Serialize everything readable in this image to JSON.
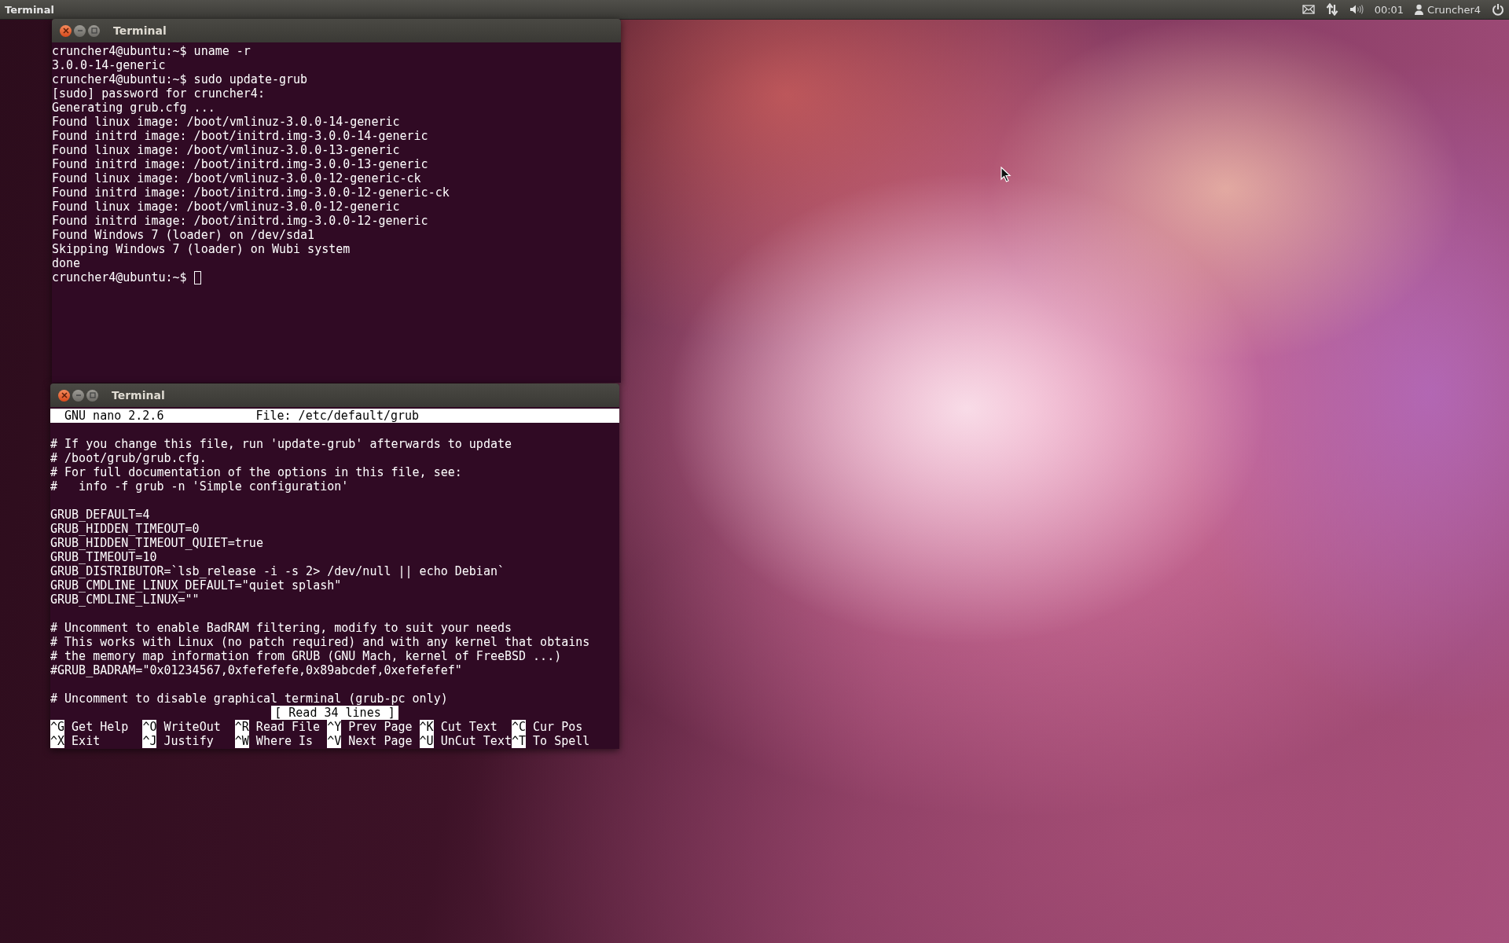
{
  "top_panel": {
    "app_title": "Terminal",
    "clock": "00:01",
    "user": "Cruncher4"
  },
  "windows": [
    {
      "kind": "shell",
      "title": "Terminal",
      "lines": [
        "cruncher4@ubuntu:~$ uname -r",
        "3.0.0-14-generic",
        "cruncher4@ubuntu:~$ sudo update-grub",
        "[sudo] password for cruncher4:",
        "Generating grub.cfg ...",
        "Found linux image: /boot/vmlinuz-3.0.0-14-generic",
        "Found initrd image: /boot/initrd.img-3.0.0-14-generic",
        "Found linux image: /boot/vmlinuz-3.0.0-13-generic",
        "Found initrd image: /boot/initrd.img-3.0.0-13-generic",
        "Found linux image: /boot/vmlinuz-3.0.0-12-generic-ck",
        "Found initrd image: /boot/initrd.img-3.0.0-12-generic-ck",
        "Found linux image: /boot/vmlinuz-3.0.0-12-generic",
        "Found initrd image: /boot/initrd.img-3.0.0-12-generic",
        "Found Windows 7 (loader) on /dev/sda1",
        "Skipping Windows 7 (loader) on Wubi system",
        "done"
      ],
      "prompt": "cruncher4@ubuntu:~$"
    },
    {
      "kind": "nano",
      "title": "Terminal",
      "version": "GNU nano 2.2.6",
      "file": "File: /etc/default/grub",
      "paragraphs": [
        [
          "# If you change this file, run 'update-grub' afterwards to update",
          "# /boot/grub/grub.cfg.",
          "# For full documentation of the options in this file, see:",
          "#   info -f grub -n 'Simple configuration'"
        ],
        [
          "GRUB_DEFAULT=4",
          "GRUB_HIDDEN_TIMEOUT=0",
          "GRUB_HIDDEN_TIMEOUT_QUIET=true",
          "GRUB_TIMEOUT=10",
          "GRUB_DISTRIBUTOR=`lsb_release -i -s 2> /dev/null || echo Debian`",
          "GRUB_CMDLINE_LINUX_DEFAULT=\"quiet splash\"",
          "GRUB_CMDLINE_LINUX=\"\""
        ],
        [
          "# Uncomment to enable BadRAM filtering, modify to suit your needs",
          "# This works with Linux (no patch required) and with any kernel that obtains",
          "# the memory map information from GRUB (GNU Mach, kernel of FreeBSD ...)",
          "#GRUB_BADRAM=\"0x01234567,0xfefefefe,0x89abcdef,0xefefefef\""
        ],
        [
          "# Uncomment to disable graphical terminal (grub-pc only)"
        ]
      ],
      "status": "[ Read 34 lines ]",
      "shortcuts": [
        [
          {
            "key": "^G",
            "label": "Get Help"
          },
          {
            "key": "^O",
            "label": "WriteOut"
          },
          {
            "key": "^R",
            "label": "Read File"
          },
          {
            "key": "^Y",
            "label": "Prev Page"
          },
          {
            "key": "^K",
            "label": "Cut Text"
          },
          {
            "key": "^C",
            "label": "Cur Pos"
          }
        ],
        [
          {
            "key": "^X",
            "label": "Exit"
          },
          {
            "key": "^J",
            "label": "Justify"
          },
          {
            "key": "^W",
            "label": "Where Is"
          },
          {
            "key": "^V",
            "label": "Next Page"
          },
          {
            "key": "^U",
            "label": "UnCut Text"
          },
          {
            "key": "^T",
            "label": "To Spell"
          }
        ]
      ]
    }
  ]
}
